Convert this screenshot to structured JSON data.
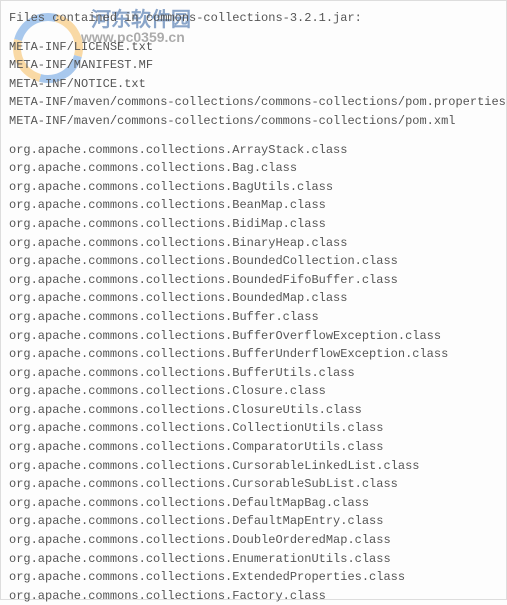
{
  "watermark": {
    "brand_text": "河东软件园",
    "url_text": "www.pc0359.cn"
  },
  "header": "Files contained in commons-collections-3.2.1.jar:",
  "meta_inf_lines": [
    "META-INF/LICENSE.txt",
    "META-INF/MANIFEST.MF",
    "META-INF/NOTICE.txt",
    "META-INF/maven/commons-collections/commons-collections/pom.properties",
    "META-INF/maven/commons-collections/commons-collections/pom.xml"
  ],
  "class_lines": [
    "org.apache.commons.collections.ArrayStack.class",
    "org.apache.commons.collections.Bag.class",
    "org.apache.commons.collections.BagUtils.class",
    "org.apache.commons.collections.BeanMap.class",
    "org.apache.commons.collections.BidiMap.class",
    "org.apache.commons.collections.BinaryHeap.class",
    "org.apache.commons.collections.BoundedCollection.class",
    "org.apache.commons.collections.BoundedFifoBuffer.class",
    "org.apache.commons.collections.BoundedMap.class",
    "org.apache.commons.collections.Buffer.class",
    "org.apache.commons.collections.BufferOverflowException.class",
    "org.apache.commons.collections.BufferUnderflowException.class",
    "org.apache.commons.collections.BufferUtils.class",
    "org.apache.commons.collections.Closure.class",
    "org.apache.commons.collections.ClosureUtils.class",
    "org.apache.commons.collections.CollectionUtils.class",
    "org.apache.commons.collections.ComparatorUtils.class",
    "org.apache.commons.collections.CursorableLinkedList.class",
    "org.apache.commons.collections.CursorableSubList.class",
    "org.apache.commons.collections.DefaultMapBag.class",
    "org.apache.commons.collections.DefaultMapEntry.class",
    "org.apache.commons.collections.DoubleOrderedMap.class",
    "org.apache.commons.collections.EnumerationUtils.class",
    "org.apache.commons.collections.ExtendedProperties.class",
    "org.apache.commons.collections.Factory.class"
  ]
}
